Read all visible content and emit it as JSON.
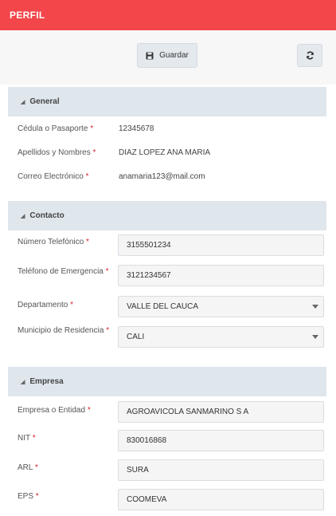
{
  "header": {
    "title": "PERFIL"
  },
  "toolbar": {
    "save_label": "Guardar"
  },
  "sections": {
    "general": {
      "title": "General",
      "fields": [
        {
          "label": "Cédula o Pasaporte",
          "value": "12345678"
        },
        {
          "label": "Apellidos y Nombres",
          "value": "DIAZ LOPEZ ANA MARIA"
        },
        {
          "label": "Correo Electrónico",
          "value": "anamaria123@mail.com"
        }
      ]
    },
    "contacto": {
      "title": "Contacto",
      "fields": [
        {
          "label": "Número Telefónico",
          "value": "3155501234"
        },
        {
          "label": "Teléfono de Emergencia",
          "value": "3121234567"
        },
        {
          "label": "Departamento",
          "value": "VALLE DEL CAUCA"
        },
        {
          "label": "Municipio de Residencia",
          "value": "CALI"
        }
      ]
    },
    "empresa": {
      "title": "Empresa",
      "fields": [
        {
          "label": "Empresa o Entidad",
          "value": "AGROAVICOLA SANMARINO S A"
        },
        {
          "label": "NIT",
          "value": "830016868"
        },
        {
          "label": "ARL",
          "value": "SURA"
        },
        {
          "label": "EPS",
          "value": "COOMEVA"
        }
      ]
    }
  },
  "required_marker": "*",
  "colors": {
    "header_bg": "#f2464a",
    "section_header_bg": "#dfe6ec",
    "required": "#d9232d"
  },
  "icons": {
    "save": "floppy-disk-icon",
    "refresh": "refresh-icon",
    "section_toggle": "caret-icon"
  }
}
